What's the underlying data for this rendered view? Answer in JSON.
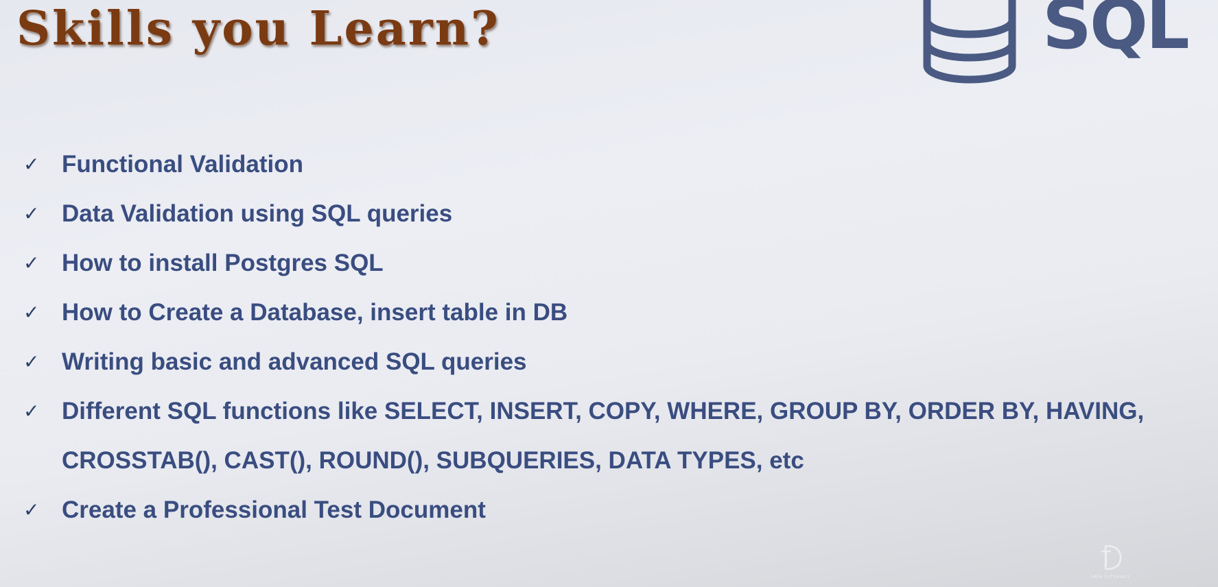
{
  "title": "Skills you Learn?",
  "logo": {
    "icon": "database-cylinder-icon",
    "text": "SQL",
    "color": "#4a5a82"
  },
  "skills": [
    "Functional Validation",
    "Data Validation using SQL queries",
    "How to install Postgres SQL",
    "How to Create a Database, insert table in DB",
    "Writing basic and advanced SQL queries",
    "Different SQL functions like SELECT, INSERT, COPY, WHERE, GROUP BY, ORDER BY, HAVING, CROSSTAB(), CAST(), ROUND(), SUBQUERIES, DATA TYPES, etc",
    "Create a Professional Test Document"
  ],
  "check_symbol": "✓",
  "watermark": {
    "text": "DATA TUTORIALS",
    "icon": "data-tutorials-logo-icon"
  },
  "colors": {
    "title": "#7a3a12",
    "text": "#3a4d80",
    "check": "#2e3f66"
  }
}
